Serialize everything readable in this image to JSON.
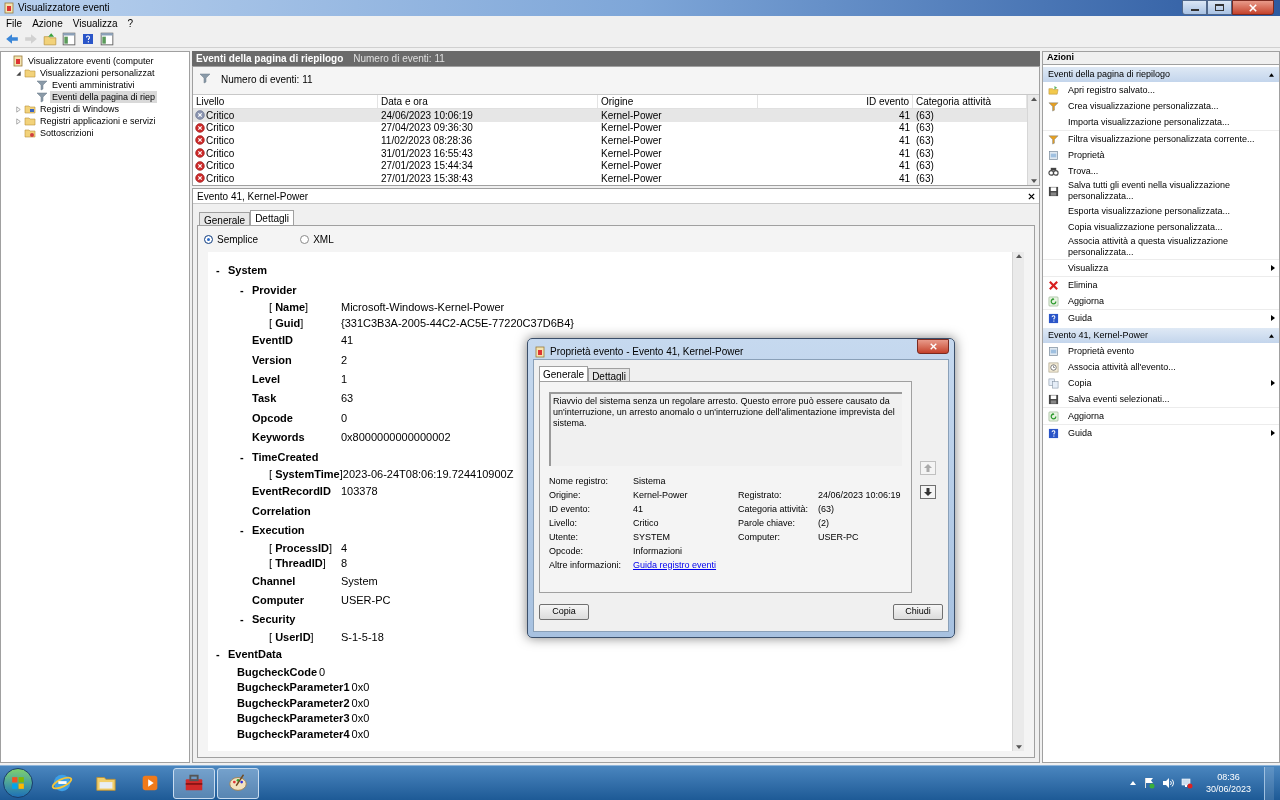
{
  "window": {
    "title": "Visualizzatore eventi"
  },
  "menu": [
    "File",
    "Azione",
    "Visualizza",
    "?"
  ],
  "toolbar": [
    {
      "kind": "back",
      "disabled": false
    },
    {
      "kind": "forward",
      "disabled": true
    },
    {
      "kind": "up",
      "disabled": false
    },
    {
      "kind": "pane",
      "disabled": false
    },
    {
      "kind": "help",
      "disabled": false
    },
    {
      "kind": "pane",
      "disabled": false
    }
  ],
  "tree": [
    {
      "label": "Visualizzatore eventi (computer",
      "kind": "viewer",
      "selected": false,
      "children": [
        {
          "label": "Visualizzazioni personalizzat",
          "kind": "folder",
          "expanded": true,
          "selected": false,
          "children": [
            {
              "label": "Eventi amministrativi",
              "kind": "filter",
              "selected": false
            },
            {
              "label": "Eventi della pagina di riep",
              "kind": "filter",
              "selected": true
            }
          ]
        },
        {
          "label": "Registri di Windows",
          "kind": "logs",
          "expanded": false,
          "selected": false
        },
        {
          "label": "Registri applicazioni e servizi",
          "kind": "folder",
          "expanded": false,
          "selected": false
        },
        {
          "label": "Sottoscrizioni",
          "kind": "subs",
          "selected": false
        }
      ]
    }
  ],
  "summary": {
    "title": "Eventi della pagina di riepilogo",
    "count": "Numero di eventi: 11",
    "filter_label": "Numero di eventi: 11"
  },
  "table": {
    "columns": [
      "Livello",
      "Data e ora",
      "Origine",
      "ID evento",
      "Categoria attività"
    ],
    "rows": [
      {
        "level": "Critico",
        "date": "24/06/2023 10:06:19",
        "source": "Kernel-Power",
        "id": "41",
        "category": "(63)",
        "selected": true
      },
      {
        "level": "Critico",
        "date": "27/04/2023 09:36:30",
        "source": "Kernel-Power",
        "id": "41",
        "category": "(63)",
        "selected": false
      },
      {
        "level": "Critico",
        "date": "11/02/2023 08:28:36",
        "source": "Kernel-Power",
        "id": "41",
        "category": "(63)",
        "selected": false
      },
      {
        "level": "Critico",
        "date": "31/01/2023 16:55:43",
        "source": "Kernel-Power",
        "id": "41",
        "category": "(63)",
        "selected": false
      },
      {
        "level": "Critico",
        "date": "27/01/2023 15:44:34",
        "source": "Kernel-Power",
        "id": "41",
        "category": "(63)",
        "selected": false
      },
      {
        "level": "Critico",
        "date": "27/01/2023 15:38:43",
        "source": "Kernel-Power",
        "id": "41",
        "category": "(63)",
        "selected": false
      }
    ]
  },
  "details": {
    "title": "Evento 41, Kernel-Power",
    "tabs": [
      {
        "label": "Generale",
        "selected": false
      },
      {
        "label": "Dettagli",
        "selected": true
      }
    ],
    "view_options": [
      {
        "label": "Semplice",
        "selected": true
      },
      {
        "label": "XML",
        "selected": false
      }
    ],
    "nodes": [
      {
        "kind": "element",
        "marker": "-",
        "label": "System",
        "children": [
          {
            "kind": "element",
            "marker": "-",
            "label": "Provider",
            "children": [
              {
                "kind": "attribute",
                "label": "[ **Name**]",
                "value": "Microsoft-Windows-Kernel-Power"
              },
              {
                "kind": "attribute",
                "label": "[ **Guid**]",
                "value": "{331C3B3A-2005-44C2-AC5E-77220C37D6B4}"
              }
            ]
          },
          {
            "kind": "element",
            "label": "EventID",
            "value": "41"
          },
          {
            "kind": "element",
            "label": "Version",
            "value": "2"
          },
          {
            "kind": "element",
            "label": "Level",
            "value": "1"
          },
          {
            "kind": "element",
            "label": "Task",
            "value": "63"
          },
          {
            "kind": "element",
            "label": "Opcode",
            "value": "0"
          },
          {
            "kind": "element",
            "label": "Keywords",
            "value": "0x8000000000000002"
          },
          {
            "kind": "element",
            "marker": "-",
            "label": "TimeCreated",
            "children": [
              {
                "kind": "attribute",
                "label": "[ **SystemTime**]",
                "value": "2023-06-24T08:06:19.724410900Z"
              }
            ]
          },
          {
            "kind": "element",
            "label": "EventRecordID",
            "value": "103378"
          },
          {
            "kind": "element",
            "label": "Correlation"
          },
          {
            "kind": "element",
            "marker": "-",
            "label": "Execution",
            "children": [
              {
                "kind": "attribute",
                "label": "[ **ProcessID**]",
                "value": "4"
              },
              {
                "kind": "attribute",
                "label": "[ **ThreadID**]",
                "value": "8"
              }
            ]
          },
          {
            "kind": "element",
            "label": "Channel",
            "value": "System"
          },
          {
            "kind": "element",
            "label": "Computer",
            "value": "USER-PC"
          },
          {
            "kind": "element",
            "marker": "-",
            "label": "Security",
            "children": [
              {
                "kind": "attribute",
                "label": "[ **UserID**]",
                "value": "S-1-5-18"
              }
            ]
          }
        ]
      },
      {
        "kind": "element",
        "marker": "-",
        "label": "EventData",
        "children": [
          {
            "kind": "data",
            "label": "BugcheckCode",
            "value": "0"
          },
          {
            "kind": "data",
            "label": "BugcheckParameter1",
            "value": "0x0"
          },
          {
            "kind": "data",
            "label": "BugcheckParameter2",
            "value": "0x0"
          },
          {
            "kind": "data",
            "label": "BugcheckParameter3",
            "value": "0x0"
          },
          {
            "kind": "data",
            "label": "BugcheckParameter4",
            "value": "0x0"
          }
        ]
      }
    ]
  },
  "actions": {
    "title": "Azioni",
    "sections": [
      {
        "title": "Eventi della pagina di riepilogo",
        "expanded": true,
        "groups": [
          [
            {
              "label": "Apri registro salvato...",
              "kind": "open",
              "submenu": false
            },
            {
              "label": "Crea visualizzazione personalizzata...",
              "kind": "filter",
              "submenu": false
            },
            {
              "label": "Importa visualizzazione personalizzata...",
              "kind": "none",
              "submenu": false
            }
          ],
          [
            {
              "label": "Filtra visualizzazione personalizzata corrente...",
              "kind": "filter",
              "submenu": false
            },
            {
              "label": "Proprietà",
              "kind": "properties",
              "submenu": false
            },
            {
              "label": "Trova...",
              "kind": "find",
              "submenu": false
            },
            {
              "label": "Salva tutti gli eventi nella visualizzazione personalizzata...",
              "kind": "save",
              "submenu": false
            },
            {
              "label": "Esporta visualizzazione personalizzata...",
              "kind": "none",
              "submenu": false
            },
            {
              "label": "Copia visualizzazione personalizzata...",
              "kind": "none",
              "submenu": false
            },
            {
              "label": "Associa attività a questa visualizzazione personalizzata...",
              "kind": "none",
              "submenu": false
            }
          ],
          [
            {
              "label": "Visualizza",
              "kind": "none",
              "submenu": true
            }
          ],
          [
            {
              "label": "Elimina",
              "kind": "delete",
              "submenu": false
            },
            {
              "label": "Aggiorna",
              "kind": "refresh",
              "submenu": false
            }
          ],
          [
            {
              "label": "Guida",
              "kind": "help",
              "submenu": true
            }
          ]
        ]
      },
      {
        "title": "Evento 41, Kernel-Power",
        "expanded": true,
        "groups": [
          [
            {
              "label": "Proprietà evento",
              "kind": "properties",
              "submenu": false
            },
            {
              "label": "Associa attività all'evento...",
              "kind": "task",
              "submenu": false
            },
            {
              "label": "Copia",
              "kind": "copy",
              "submenu": true
            },
            {
              "label": "Salva eventi selezionati...",
              "kind": "save",
              "submenu": false
            }
          ],
          [
            {
              "label": "Aggiorna",
              "kind": "refresh",
              "submenu": false
            }
          ],
          [
            {
              "label": "Guida",
              "kind": "help",
              "submenu": true
            }
          ]
        ]
      }
    ]
  },
  "dialog": {
    "title": "Proprietà evento - Evento 41, Kernel-Power",
    "tabs": [
      {
        "label": "Generale",
        "selected": true
      },
      {
        "label": "Dettagli",
        "selected": false
      }
    ],
    "description": "Riavvio del sistema senza un regolare arresto. Questo errore può essere causato da un'interruzione, un arresto anomalo o un'interruzione dell'alimentazione imprevista del sistema.",
    "rows": [
      {
        "kind": "text",
        "label": "Nome registro:",
        "value": "Sistema"
      },
      {
        "kind": "text",
        "label": "Origine:",
        "value": "Kernel-Power",
        "right": {
          "label": "Registrato:",
          "value": "24/06/2023 10:06:19"
        }
      },
      {
        "kind": "text",
        "label": "ID evento:",
        "value": "41",
        "right": {
          "label": "Categoria attività:",
          "value": "(63)"
        }
      },
      {
        "kind": "text",
        "label": "Livello:",
        "value": "Critico",
        "right": {
          "label": "Parole chiave:",
          "value": "(2)"
        }
      },
      {
        "kind": "text",
        "label": "Utente:",
        "value": "SYSTEM",
        "right": {
          "label": "Computer:",
          "value": "USER-PC"
        }
      },
      {
        "kind": "text",
        "label": "Opcode:",
        "value": "Informazioni"
      },
      {
        "kind": "link",
        "label": "Altre informazioni:",
        "value": "Guida registro eventi"
      }
    ],
    "buttons": [
      "Copia",
      "Chiudi"
    ]
  },
  "taskbar": {
    "apps": [
      {
        "kind": "browser",
        "open": false
      },
      {
        "kind": "explorer",
        "open": false
      },
      {
        "kind": "media",
        "open": false
      },
      {
        "kind": "toolbox",
        "open": true
      },
      {
        "kind": "paint",
        "open": true
      }
    ],
    "time": "08:36",
    "date": "30/06/2023"
  }
}
